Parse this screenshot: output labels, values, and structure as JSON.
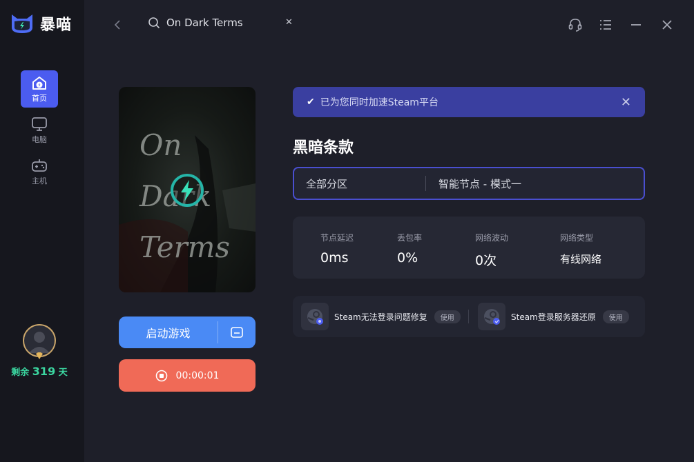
{
  "app": {
    "name": "暴喵"
  },
  "sidebar": {
    "items": [
      {
        "label": "首页",
        "icon": "home-bolt-icon",
        "active": true
      },
      {
        "label": "电脑",
        "icon": "monitor-icon",
        "active": false
      },
      {
        "label": "主机",
        "icon": "gamepad-icon",
        "active": false
      }
    ],
    "subscription": {
      "prefix": "剩余",
      "days": "319",
      "suffix": "天"
    }
  },
  "search": {
    "query": "On Dark Terms",
    "clear_icon": "close-icon"
  },
  "window_controls": [
    "headset-icon",
    "menu-list-icon",
    "minimize-icon",
    "close-icon"
  ],
  "game": {
    "cover_lines": [
      "On",
      "Dark",
      "Terms"
    ],
    "title": "黑暗条款",
    "start_label": "启动游戏",
    "timer": "00:00:01"
  },
  "banner": {
    "text": "已为您同时加速Steam平台"
  },
  "selector": {
    "region": "全部分区",
    "node": "智能节点 - 模式一"
  },
  "stats": [
    {
      "label": "节点延迟",
      "value": "0ms"
    },
    {
      "label": "丢包率",
      "value": "0%"
    },
    {
      "label": "网络波动",
      "value": "0次"
    },
    {
      "label": "网络类型",
      "value": "有线网络"
    }
  ],
  "tools": [
    {
      "name": "Steam无法登录问题修复",
      "action": "使用",
      "icon": "steam-fix-icon"
    },
    {
      "name": "Steam登录服务器还原",
      "action": "使用",
      "icon": "steam-restore-icon"
    }
  ],
  "colors": {
    "accent": "#4b5cf0",
    "start": "#4a8af5",
    "stop": "#f06a57",
    "banner": "#3a3fa0",
    "days": "#3bd6a0"
  }
}
